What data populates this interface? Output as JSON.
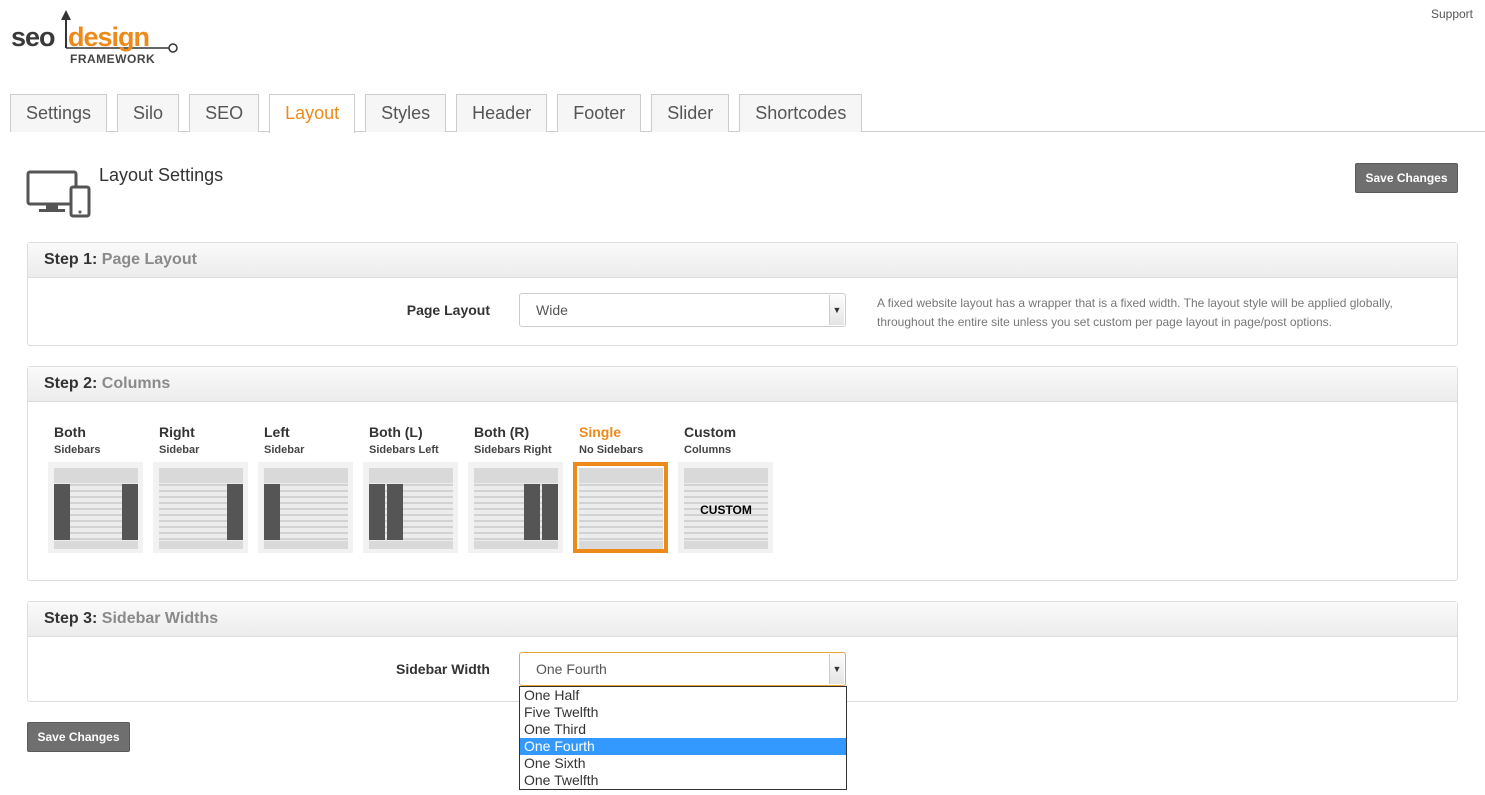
{
  "header": {
    "support_link": "Support"
  },
  "logo": {
    "part1": "seo",
    "part2": "design",
    "part3": "FRAMEWORK"
  },
  "tabs": [
    {
      "label": "Settings"
    },
    {
      "label": "Silo"
    },
    {
      "label": "SEO"
    },
    {
      "label": "Layout"
    },
    {
      "label": "Styles"
    },
    {
      "label": "Header"
    },
    {
      "label": "Footer"
    },
    {
      "label": "Slider"
    },
    {
      "label": "Shortcodes"
    }
  ],
  "active_tab": "Layout",
  "page": {
    "title": "Layout Settings",
    "save_label": "Save Changes"
  },
  "step1": {
    "prefix": "Step 1:",
    "name": "Page Layout",
    "field_label": "Page Layout",
    "value": "Wide",
    "help": "A fixed website layout has a wrapper that is a fixed width. The layout style will be applied globally, throughout the entire site unless you set custom per page layout in page/post options."
  },
  "step2": {
    "prefix": "Step 2:",
    "name": "Columns",
    "options": [
      {
        "title": "Both",
        "subtitle": "Sidebars"
      },
      {
        "title": "Right",
        "subtitle": "Sidebar"
      },
      {
        "title": "Left",
        "subtitle": "Sidebar"
      },
      {
        "title": "Both (L)",
        "subtitle": "Sidebars Left"
      },
      {
        "title": "Both (R)",
        "subtitle": "Sidebars Right"
      },
      {
        "title": "Single",
        "subtitle": "No Sidebars"
      },
      {
        "title": "Custom",
        "subtitle": "Columns"
      }
    ],
    "selected": "Single",
    "custom_thumb_text": "CUSTOM"
  },
  "step3": {
    "prefix": "Step 3:",
    "name": "Sidebar Widths",
    "field_label": "Sidebar Width",
    "value": "One Fourth",
    "options": [
      "One Half",
      "Five Twelfth",
      "One Third",
      "One Fourth",
      "One Sixth",
      "One Twelfth"
    ]
  },
  "colors": {
    "accent": "#ee8a1a",
    "button": "#6f6f6f",
    "highlight": "#3399ff"
  }
}
